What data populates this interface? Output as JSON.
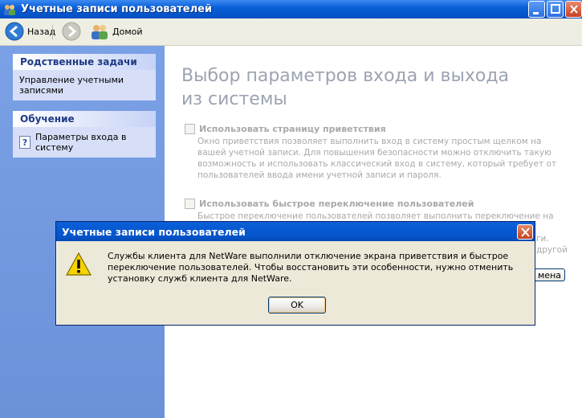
{
  "window": {
    "title": "Учетные записи пользователей"
  },
  "toolbar": {
    "back_label": "Назад",
    "home_label": "Домой"
  },
  "sidebar": {
    "related": {
      "header": "Родственные задачи",
      "items": [
        "Управление учетными записями"
      ]
    },
    "learn": {
      "header": "Обучение",
      "items": [
        "Параметры входа в систему"
      ]
    }
  },
  "main": {
    "title": "Выбор параметров входа и выхода из системы",
    "option1": {
      "label": "Использовать страницу приветствия",
      "description": "Окно приветствия позволяет выполнить вход в систему простым щелком на вашей учетной записи. Для повышения безопасности можно отключить такую возможность и использовать классический вход в систему, который требует от пользователей ввода имени учетной записи и пароля."
    },
    "option2": {
      "label": "Использовать быстрое переключение пользователей",
      "description_visible": "Быстрое переключение пользователей позволяет выполнить переключение на учетную",
      "description_tail1": "другой",
      "description_tail2": "ги."
    },
    "partial_button": "мена"
  },
  "dialog": {
    "title": "Учетные записи пользователей",
    "message": "Службы клиента для NetWare выполнили отключение экрана приветствия и быстрое переключение пользователей. Чтобы восстановить эти особенности, нужно отменить установку служб клиента для NetWare.",
    "ok_label": "OK",
    "icon": "warning-icon"
  }
}
